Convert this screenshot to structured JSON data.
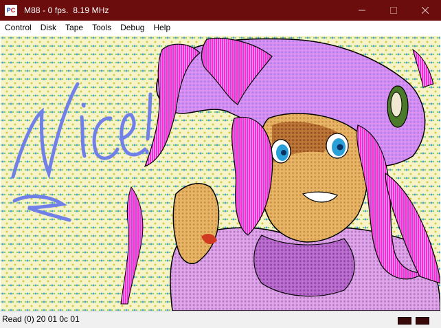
{
  "window": {
    "title": "M88 - 0 fps.  8.19 MHz",
    "icon_label_p": "P",
    "icon_label_c": "C"
  },
  "menu": {
    "items": [
      {
        "label": "Control"
      },
      {
        "label": "Disk"
      },
      {
        "label": "Tape"
      },
      {
        "label": "Tools"
      },
      {
        "label": "Debug"
      },
      {
        "label": "Help"
      }
    ]
  },
  "screen": {
    "handwriting": "Nice!"
  },
  "status": {
    "text": "Read (0) 20 01 0c 01"
  },
  "colors": {
    "titlebar": "#6b0d0d",
    "hair": "#ff22c8",
    "skin": "#e0a860",
    "background": "#f6f3c8",
    "sweater": "#cf8ad8",
    "text_scribble": "#7080e8",
    "led": "#3a0a0a"
  }
}
